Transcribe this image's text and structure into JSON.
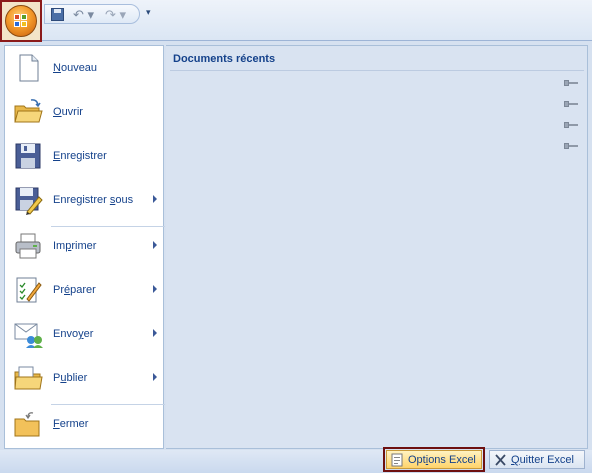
{
  "quick_access": {
    "save_icon": "save-icon",
    "undo_icon": "undo-icon",
    "redo_icon": "redo-icon",
    "customize_icon": "customize-arrow-icon",
    "undo_glyph": "↶ ▾",
    "redo_glyph": "↷ ▾",
    "customize_glyph": "▾"
  },
  "commands": [
    {
      "key": "nouveau",
      "label_pre": "",
      "label_ul": "N",
      "label_post": "ouveau",
      "submenu": false,
      "icon": "new-document-icon"
    },
    {
      "key": "ouvrir",
      "label_pre": "",
      "label_ul": "O",
      "label_post": "uvrir",
      "submenu": false,
      "icon": "open-folder-icon"
    },
    {
      "key": "enregistrer",
      "label_pre": "",
      "label_ul": "E",
      "label_post": "nregistrer",
      "submenu": false,
      "icon": "save-disk-icon"
    },
    {
      "key": "enregistrer-sous",
      "label_pre": "Enregistrer ",
      "label_ul": "s",
      "label_post": "ous",
      "submenu": true,
      "icon": "save-as-icon"
    },
    {
      "key": "imprimer",
      "label_pre": "Im",
      "label_ul": "p",
      "label_post": "rimer",
      "submenu": true,
      "icon": "printer-icon"
    },
    {
      "key": "preparer",
      "label_pre": "Pr",
      "label_ul": "é",
      "label_post": "parer",
      "submenu": true,
      "icon": "prepare-document-icon"
    },
    {
      "key": "envoyer",
      "label_pre": "Envo",
      "label_ul": "y",
      "label_post": "er",
      "submenu": true,
      "icon": "send-mail-icon"
    },
    {
      "key": "publier",
      "label_pre": "P",
      "label_ul": "u",
      "label_post": "blier",
      "submenu": true,
      "icon": "publish-folder-icon"
    },
    {
      "key": "fermer",
      "label_pre": "",
      "label_ul": "F",
      "label_post": "ermer",
      "submenu": false,
      "icon": "close-folder-icon"
    }
  ],
  "recent": {
    "title": "Documents récents",
    "pins": [
      "pin-icon",
      "pin-icon",
      "pin-icon",
      "pin-icon"
    ]
  },
  "footer": {
    "options_pre": "Opt",
    "options_ul": "i",
    "options_post": "ons Excel",
    "exit_pre": "",
    "exit_ul": "Q",
    "exit_post": "uitter Excel"
  },
  "colors": {
    "text": "#15428b",
    "panel_bg": "#d6e1f0",
    "highlight_frame": "#8b1a1a"
  }
}
